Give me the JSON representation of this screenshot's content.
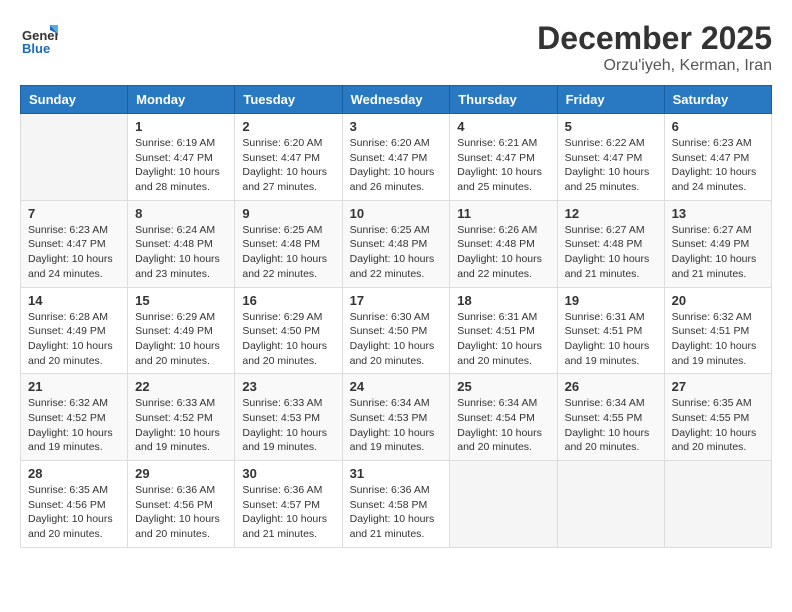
{
  "header": {
    "logo_line1": "General",
    "logo_line2": "Blue",
    "month_title": "December 2025",
    "subtitle": "Orzu'iyeh, Kerman, Iran"
  },
  "days_of_week": [
    "Sunday",
    "Monday",
    "Tuesday",
    "Wednesday",
    "Thursday",
    "Friday",
    "Saturday"
  ],
  "weeks": [
    [
      {
        "day": "",
        "info": ""
      },
      {
        "day": "1",
        "info": "Sunrise: 6:19 AM\nSunset: 4:47 PM\nDaylight: 10 hours\nand 28 minutes."
      },
      {
        "day": "2",
        "info": "Sunrise: 6:20 AM\nSunset: 4:47 PM\nDaylight: 10 hours\nand 27 minutes."
      },
      {
        "day": "3",
        "info": "Sunrise: 6:20 AM\nSunset: 4:47 PM\nDaylight: 10 hours\nand 26 minutes."
      },
      {
        "day": "4",
        "info": "Sunrise: 6:21 AM\nSunset: 4:47 PM\nDaylight: 10 hours\nand 25 minutes."
      },
      {
        "day": "5",
        "info": "Sunrise: 6:22 AM\nSunset: 4:47 PM\nDaylight: 10 hours\nand 25 minutes."
      },
      {
        "day": "6",
        "info": "Sunrise: 6:23 AM\nSunset: 4:47 PM\nDaylight: 10 hours\nand 24 minutes."
      }
    ],
    [
      {
        "day": "7",
        "info": "Sunrise: 6:23 AM\nSunset: 4:47 PM\nDaylight: 10 hours\nand 24 minutes."
      },
      {
        "day": "8",
        "info": "Sunrise: 6:24 AM\nSunset: 4:48 PM\nDaylight: 10 hours\nand 23 minutes."
      },
      {
        "day": "9",
        "info": "Sunrise: 6:25 AM\nSunset: 4:48 PM\nDaylight: 10 hours\nand 22 minutes."
      },
      {
        "day": "10",
        "info": "Sunrise: 6:25 AM\nSunset: 4:48 PM\nDaylight: 10 hours\nand 22 minutes."
      },
      {
        "day": "11",
        "info": "Sunrise: 6:26 AM\nSunset: 4:48 PM\nDaylight: 10 hours\nand 22 minutes."
      },
      {
        "day": "12",
        "info": "Sunrise: 6:27 AM\nSunset: 4:48 PM\nDaylight: 10 hours\nand 21 minutes."
      },
      {
        "day": "13",
        "info": "Sunrise: 6:27 AM\nSunset: 4:49 PM\nDaylight: 10 hours\nand 21 minutes."
      }
    ],
    [
      {
        "day": "14",
        "info": "Sunrise: 6:28 AM\nSunset: 4:49 PM\nDaylight: 10 hours\nand 20 minutes."
      },
      {
        "day": "15",
        "info": "Sunrise: 6:29 AM\nSunset: 4:49 PM\nDaylight: 10 hours\nand 20 minutes."
      },
      {
        "day": "16",
        "info": "Sunrise: 6:29 AM\nSunset: 4:50 PM\nDaylight: 10 hours\nand 20 minutes."
      },
      {
        "day": "17",
        "info": "Sunrise: 6:30 AM\nSunset: 4:50 PM\nDaylight: 10 hours\nand 20 minutes."
      },
      {
        "day": "18",
        "info": "Sunrise: 6:31 AM\nSunset: 4:51 PM\nDaylight: 10 hours\nand 20 minutes."
      },
      {
        "day": "19",
        "info": "Sunrise: 6:31 AM\nSunset: 4:51 PM\nDaylight: 10 hours\nand 19 minutes."
      },
      {
        "day": "20",
        "info": "Sunrise: 6:32 AM\nSunset: 4:51 PM\nDaylight: 10 hours\nand 19 minutes."
      }
    ],
    [
      {
        "day": "21",
        "info": "Sunrise: 6:32 AM\nSunset: 4:52 PM\nDaylight: 10 hours\nand 19 minutes."
      },
      {
        "day": "22",
        "info": "Sunrise: 6:33 AM\nSunset: 4:52 PM\nDaylight: 10 hours\nand 19 minutes."
      },
      {
        "day": "23",
        "info": "Sunrise: 6:33 AM\nSunset: 4:53 PM\nDaylight: 10 hours\nand 19 minutes."
      },
      {
        "day": "24",
        "info": "Sunrise: 6:34 AM\nSunset: 4:53 PM\nDaylight: 10 hours\nand 19 minutes."
      },
      {
        "day": "25",
        "info": "Sunrise: 6:34 AM\nSunset: 4:54 PM\nDaylight: 10 hours\nand 20 minutes."
      },
      {
        "day": "26",
        "info": "Sunrise: 6:34 AM\nSunset: 4:55 PM\nDaylight: 10 hours\nand 20 minutes."
      },
      {
        "day": "27",
        "info": "Sunrise: 6:35 AM\nSunset: 4:55 PM\nDaylight: 10 hours\nand 20 minutes."
      }
    ],
    [
      {
        "day": "28",
        "info": "Sunrise: 6:35 AM\nSunset: 4:56 PM\nDaylight: 10 hours\nand 20 minutes."
      },
      {
        "day": "29",
        "info": "Sunrise: 6:36 AM\nSunset: 4:56 PM\nDaylight: 10 hours\nand 20 minutes."
      },
      {
        "day": "30",
        "info": "Sunrise: 6:36 AM\nSunset: 4:57 PM\nDaylight: 10 hours\nand 21 minutes."
      },
      {
        "day": "31",
        "info": "Sunrise: 6:36 AM\nSunset: 4:58 PM\nDaylight: 10 hours\nand 21 minutes."
      },
      {
        "day": "",
        "info": ""
      },
      {
        "day": "",
        "info": ""
      },
      {
        "day": "",
        "info": ""
      }
    ]
  ]
}
